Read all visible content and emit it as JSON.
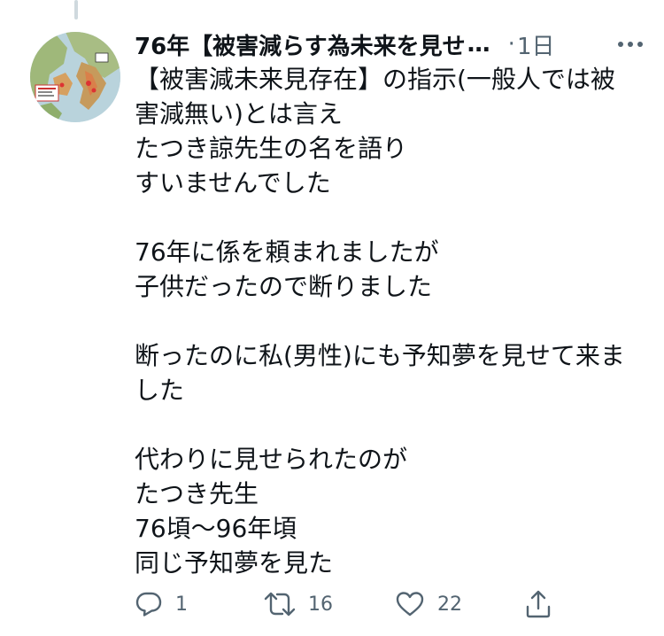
{
  "tweet": {
    "author_name": "76年【被害減らす為未来を見せ",
    "author_name_ellipsis": "…",
    "dot": "·",
    "timestamp": "1日",
    "more_icon": "more-horizontal-icon",
    "body_lines": [
      "【被害減未来見存在】の指示(一般人では被",
      "害減無い)とは言え",
      "たつき諒先生の名を語り",
      "すいませんでした",
      "",
      "76年に係を頼まれましたが",
      "子供だったので断りました",
      "",
      "断ったのに私(男性)にも予知夢を見せて来ま",
      "した",
      "",
      "代わりに見せられたのが",
      "たつき先生",
      "76頃〜96年頃",
      "同じ予知夢を見た"
    ]
  },
  "actions": {
    "reply": {
      "icon": "reply-icon",
      "count": "1"
    },
    "retweet": {
      "icon": "retweet-icon",
      "count": "16"
    },
    "like": {
      "icon": "heart-icon",
      "count": "22"
    },
    "share": {
      "icon": "share-icon"
    }
  },
  "colors": {
    "text": "#0f1419",
    "secondary": "#536471",
    "thread_line": "#cfd9de"
  }
}
